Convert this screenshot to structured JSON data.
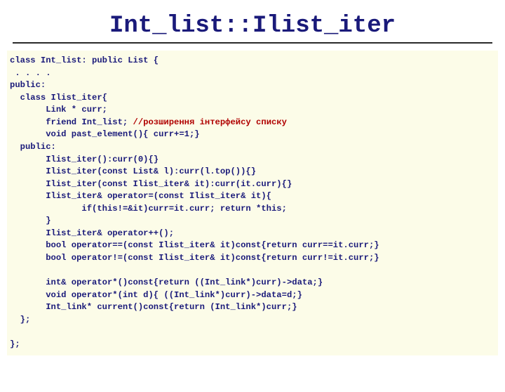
{
  "title": "Int_list::Ilist_iter",
  "code": {
    "l1": "class Int_list: public List {",
    "l2": " . . . .",
    "l3": "public:",
    "l4": "  class Ilist_iter{",
    "l5": "       Link * curr;",
    "l6a": "       friend Int_list;",
    "l6b": " //розширення інтерфейсу списку",
    "l7": "       void past_element(){ curr+=1;}",
    "l8": "  public:",
    "l9": "       Ilist_iter():curr(0){}",
    "l10": "       Ilist_iter(const List& l):curr(l.top()){}",
    "l11": "       Ilist_iter(const Ilist_iter& it):curr(it.curr){}",
    "l12": "       Ilist_iter& operator=(const Ilist_iter& it){",
    "l13": "              if(this!=&it)curr=it.curr; return *this;",
    "l14": "       }",
    "l15": "       Ilist_iter& operator++();",
    "l16": "       bool operator==(const Ilist_iter& it)const{return curr==it.curr;}",
    "l17": "       bool operator!=(const Ilist_iter& it)const{return curr!=it.curr;}",
    "blank": "",
    "l18": "       int& operator*()const{return ((Int_link*)curr)->data;}",
    "l19": "       void operator*(int d){ ((Int_link*)curr)->data=d;}",
    "l20": "       Int_link* current()const{return (Int_link*)curr;}",
    "l21": "  };",
    "blank2": "",
    "l22": "};"
  }
}
